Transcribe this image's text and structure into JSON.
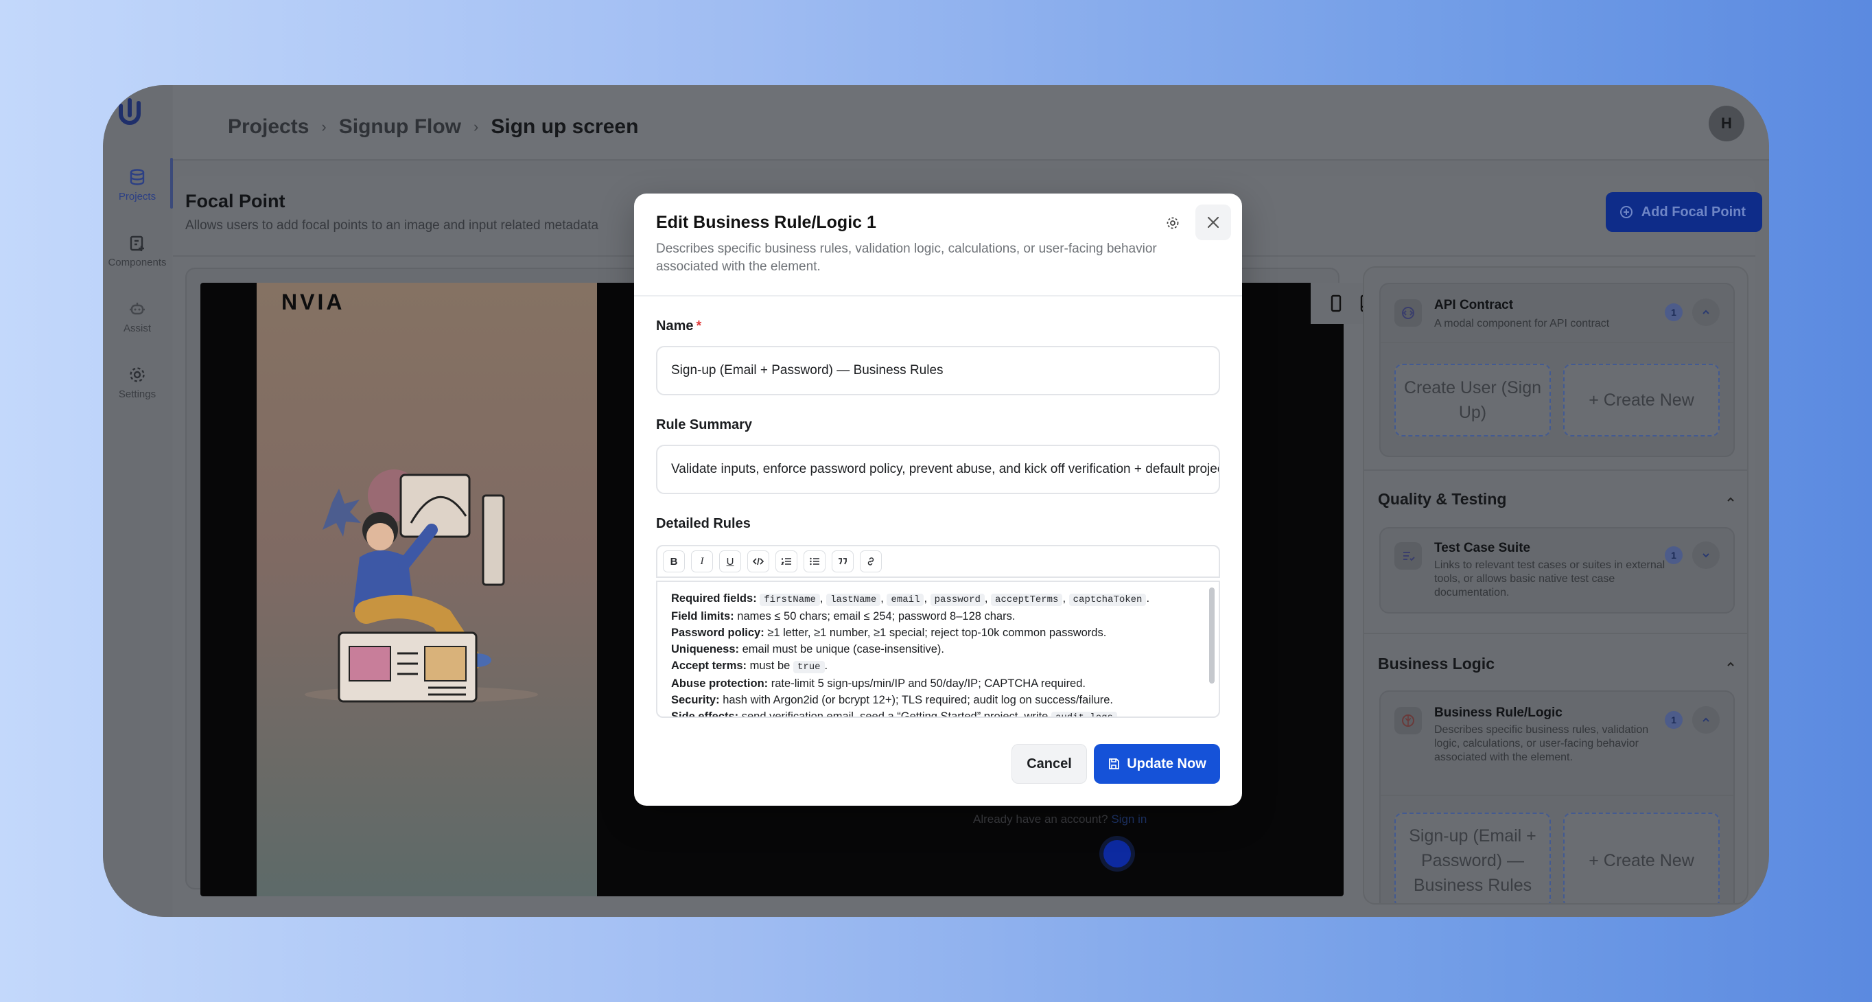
{
  "breadcrumb": {
    "projects": "Projects",
    "flow": "Signup Flow",
    "screen": "Sign up screen"
  },
  "user": {
    "initial": "H"
  },
  "sidebar": {
    "items": [
      {
        "label": "Projects",
        "icon": "database-icon"
      },
      {
        "label": "Components",
        "icon": "clipboard-plus-icon"
      },
      {
        "label": "Assist",
        "icon": "robot-icon"
      },
      {
        "label": "Settings",
        "icon": "gear-icon"
      }
    ]
  },
  "focal": {
    "title": "Focal Point",
    "desc": "Allows users to add focal points to an image and input related metadata",
    "add_button": "Add Focal Point"
  },
  "canvas": {
    "brand": "NVIA",
    "already_text": "Already have an account?",
    "signin_link": "Sign in"
  },
  "panel": {
    "api_card": {
      "title": "API Contract",
      "desc": "A modal component for API contract",
      "count": "1"
    },
    "api_tiles": {
      "item": "Create User (Sign Up)",
      "create": "+  Create New"
    },
    "quality_section": "Quality & Testing",
    "test_card": {
      "title": "Test Case Suite",
      "desc": "Links to relevant test cases or suites in external tools, or allows basic native test case documentation.",
      "count": "1"
    },
    "business_section": "Business Logic",
    "rule_card": {
      "title": "Business Rule/Logic",
      "desc": "Describes specific business rules, validation logic, calculations, or user-facing behavior associated with the element.",
      "count": "1"
    },
    "rule_tiles": {
      "item": "Sign-up (Email + Password) — Business Rules",
      "create": "+  Create New"
    }
  },
  "modal": {
    "title": "Edit Business Rule/Logic 1",
    "desc": "Describes specific business rules, validation logic, calculations, or user-facing behavior associated with the element.",
    "name_label": "Name",
    "required_mark": "*",
    "name_value": "Sign-up (Email + Password) — Business Rules",
    "summary_label": "Rule Summary",
    "summary_value": "Validate inputs, enforce password policy, prevent abuse, and kick off verification + default project creation.",
    "detailed_label": "Detailed Rules",
    "toolbar": [
      "B",
      "I",
      "U",
      "code",
      "ordered-list",
      "bullet-list",
      "quote",
      "link"
    ],
    "rules": {
      "l1_k": "Required fields:",
      "c1": "firstName",
      "c2": "lastName",
      "c3": "email",
      "c4": "password",
      "c5": "acceptTerms",
      "c6": "captchaToken",
      "l2_k": "Field limits:",
      "l2_v": "names ≤ 50 chars; email ≤ 254; password 8–128 chars.",
      "l3_k": "Password policy:",
      "l3_v": "≥1 letter, ≥1 number, ≥1 special; reject top-10k common passwords.",
      "l4_k": "Uniqueness:",
      "l4_v": "email must be unique (case-insensitive).",
      "l5_k": "Accept terms:",
      "l5_v": "must be",
      "l5_c": "true",
      "l6_k": "Abuse protection:",
      "l6_v": "rate-limit 5 sign-ups/min/IP and 50/day/IP; CAPTCHA required.",
      "l7_k": "Security:",
      "l7_v": "hash with Argon2id (or bcrypt 12+); TLS required; audit log on success/failure.",
      "l8_k": "Side effects:",
      "l8_v": "send verification email, seed a “Getting Started” project, write",
      "l8_c": "audit_logs"
    },
    "cancel": "Cancel",
    "update": "Update Now"
  }
}
